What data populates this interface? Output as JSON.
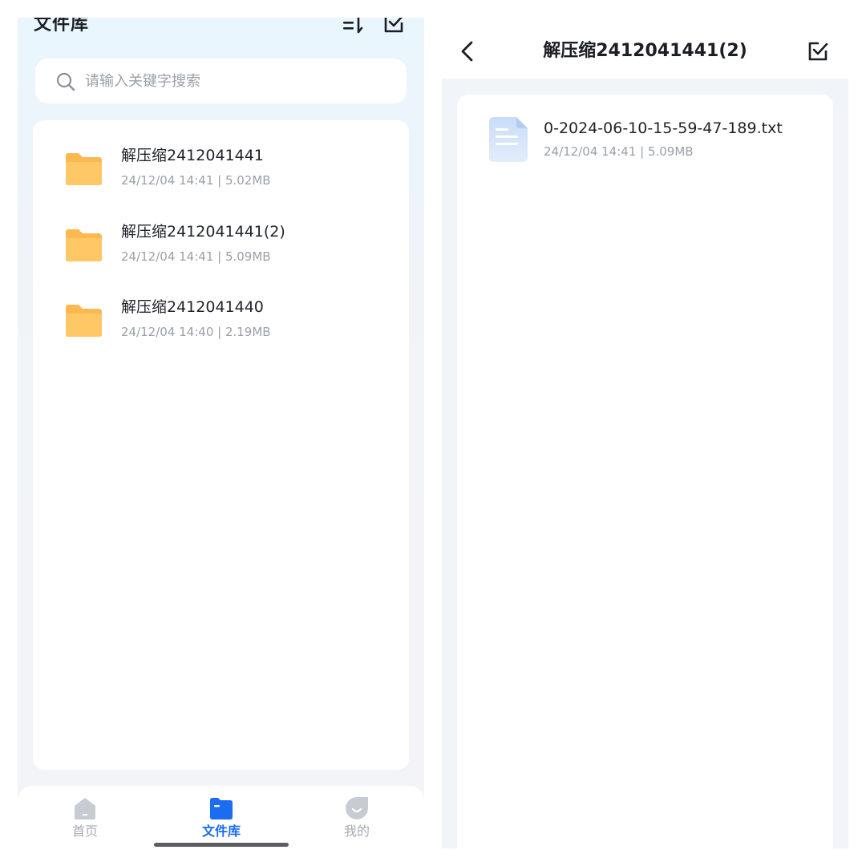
{
  "left": {
    "header": {
      "title": "文件库",
      "sort_icon": "sort-icon",
      "select_icon": "checkbox-icon"
    },
    "search": {
      "placeholder": "请输入关键字搜索",
      "value": "",
      "icon": "search-icon"
    },
    "folders": [
      {
        "name": "解压缩2412041441",
        "date": "24/12/04 14:41",
        "size": "5.02MB",
        "meta": "24/12/04 14:41 | 5.02MB",
        "icon": "folder-icon"
      },
      {
        "name": "解压缩2412041441(2)",
        "date": "24/12/04 14:41",
        "size": "5.09MB",
        "meta": "24/12/04 14:41 | 5.09MB",
        "icon": "folder-icon"
      },
      {
        "name": "解压缩2412041440",
        "date": "24/12/04 14:40",
        "size": "2.19MB",
        "meta": "24/12/04 14:40 | 2.19MB",
        "icon": "folder-icon"
      }
    ],
    "bottom_nav": [
      {
        "label": "首页",
        "icon": "home-icon",
        "active": false
      },
      {
        "label": "文件库",
        "icon": "folder-icon",
        "active": true
      },
      {
        "label": "我的",
        "icon": "profile-icon",
        "active": false
      }
    ]
  },
  "right": {
    "header": {
      "title": "解压缩2412041441(2)",
      "back_icon": "chevron-left-icon",
      "select_icon": "checkbox-icon"
    },
    "files": [
      {
        "name": "0-2024-06-10-15-59-47-189.txt",
        "date": "24/12/04 14:41",
        "size": "5.09MB",
        "meta": "24/12/04 14:41 | 5.09MB",
        "icon": "text-document-icon"
      }
    ]
  },
  "colors": {
    "accent": "#1a6cf0",
    "folder": "#fdb950",
    "text_primary": "#1f2329",
    "text_secondary": "#9aa0a8",
    "nav_inactive": "#a5abb3",
    "panel_background": "#f1f4f8"
  }
}
